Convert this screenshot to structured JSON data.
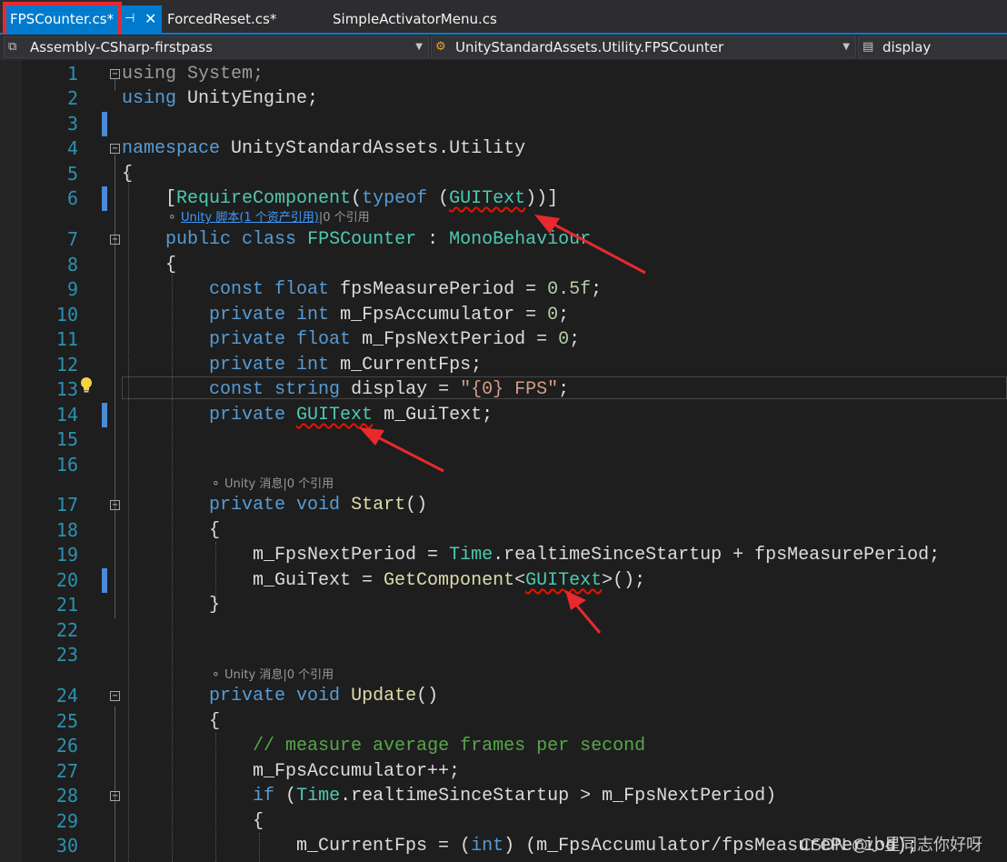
{
  "tabs": [
    {
      "label": "FPSCounter.cs*",
      "active": true,
      "pin": "⊣",
      "close": "✕"
    },
    {
      "label": "ForcedReset.cs*"
    },
    {
      "label": "SimpleActivatorMenu.cs"
    }
  ],
  "navbar": {
    "project": "Assembly-CSharp-firstpass",
    "class": "UnityStandardAssets.Utility.FPSCounter",
    "member": "display"
  },
  "line_numbers": [
    "1",
    "2",
    "3",
    "4",
    "5",
    "6",
    "7",
    "8",
    "9",
    "10",
    "11",
    "12",
    "13",
    "14",
    "15",
    "16",
    "17",
    "18",
    "19",
    "20",
    "21",
    "22",
    "23",
    "24",
    "25",
    "26",
    "27",
    "28",
    "29",
    "30"
  ],
  "code_lens": {
    "class_refs": {
      "link": "Unity 脚本(1 个资产引用)",
      "rest": "|0 个引用"
    },
    "start_refs": "Unity 消息|0 个引用",
    "update_refs": "Unity 消息|0 个引用"
  },
  "watermark": "CSDN @小星同志你好呀",
  "colors": {
    "accent": "#007acc",
    "keyword": "#569cd6",
    "type": "#4ec9b0",
    "string": "#d69d85",
    "comment": "#57a64a",
    "highlight_box": "#e8292e",
    "arrow": "#e8292e"
  },
  "icons": {
    "lightbulb": "lightbulb-icon",
    "fold": "collapse-icon",
    "nav_project": "csharp-project-icon",
    "nav_class": "class-icon",
    "nav_member": "field-icon"
  }
}
